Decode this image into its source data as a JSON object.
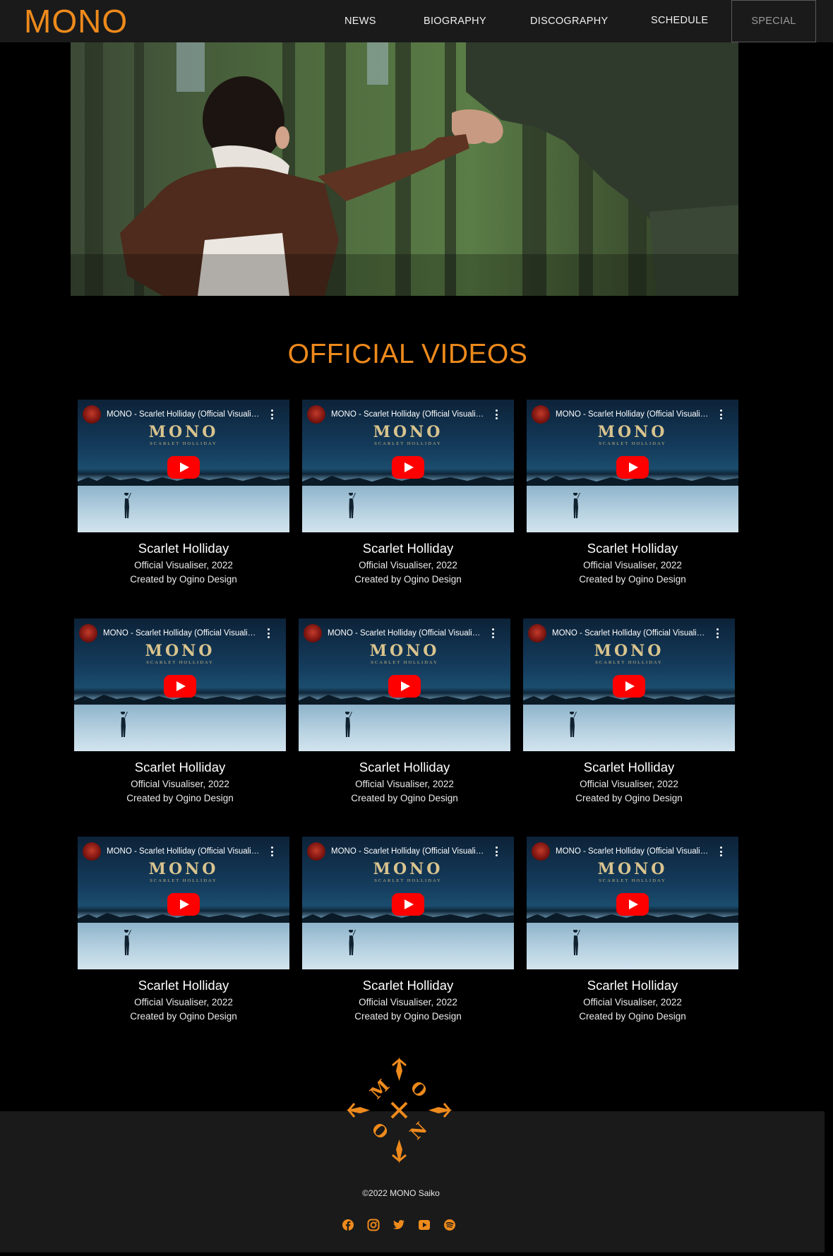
{
  "header": {
    "logo": "MONO",
    "nav": {
      "news": "NEWS",
      "biography": "BIOGRAPHY",
      "discography": "DISCOGRAPHY",
      "schedule": "SCHEDULE",
      "special": "SPECIAL"
    }
  },
  "section": {
    "title": "OFFICIAL VIDEOS"
  },
  "videos": [
    {
      "embed_title": "MONO - Scarlet Holliday (Official Visualiser)",
      "wordmark": "MONO",
      "wordmark_sub": "SCARLET HOLLIDAY",
      "title": "Scarlet Holliday",
      "line1": "Official Visualiser, 2022",
      "line2": "Created by Ogino Design"
    },
    {
      "embed_title": "MONO - Scarlet Holliday (Official Visualiser)",
      "wordmark": "MONO",
      "wordmark_sub": "SCARLET HOLLIDAY",
      "title": "Scarlet Holliday",
      "line1": "Official Visualiser, 2022",
      "line2": "Created by Ogino Design"
    },
    {
      "embed_title": "MONO - Scarlet Holliday (Official Visualiser)",
      "wordmark": "MONO",
      "wordmark_sub": "SCARLET HOLLIDAY",
      "title": "Scarlet Holliday",
      "line1": "Official Visualiser, 2022",
      "line2": "Created by Ogino Design"
    },
    {
      "embed_title": "MONO - Scarlet Holliday (Official Visualiser)",
      "wordmark": "MONO",
      "wordmark_sub": "SCARLET HOLLIDAY",
      "title": "Scarlet Holliday",
      "line1": "Official Visualiser, 2022",
      "line2": "Created by Ogino Design"
    },
    {
      "embed_title": "MONO - Scarlet Holliday (Official Visualiser)",
      "wordmark": "MONO",
      "wordmark_sub": "SCARLET HOLLIDAY",
      "title": "Scarlet Holliday",
      "line1": "Official Visualiser, 2022",
      "line2": "Created by Ogino Design"
    },
    {
      "embed_title": "MONO - Scarlet Holliday (Official Visualiser)",
      "wordmark": "MONO",
      "wordmark_sub": "SCARLET HOLLIDAY",
      "title": "Scarlet Holliday",
      "line1": "Official Visualiser, 2022",
      "line2": "Created by Ogino Design"
    },
    {
      "embed_title": "MONO - Scarlet Holliday (Official Visualiser)",
      "wordmark": "MONO",
      "wordmark_sub": "SCARLET HOLLIDAY",
      "title": "Scarlet Holliday",
      "line1": "Official Visualiser, 2022",
      "line2": "Created by Ogino Design"
    },
    {
      "embed_title": "MONO - Scarlet Holliday (Official Visualiser)",
      "wordmark": "MONO",
      "wordmark_sub": "SCARLET HOLLIDAY",
      "title": "Scarlet Holliday",
      "line1": "Official Visualiser, 2022",
      "line2": "Created by Ogino Design"
    },
    {
      "embed_title": "MONO - Scarlet Holliday (Official Visualiser)",
      "wordmark": "MONO",
      "wordmark_sub": "SCARLET HOLLIDAY",
      "title": "Scarlet Holliday",
      "line1": "Official Visualiser, 2022",
      "line2": "Created by Ogino Design"
    }
  ],
  "footer": {
    "emblem_letters": [
      "M",
      "O",
      "N",
      "O"
    ],
    "copyright": "©2022 MONO Saiko",
    "social": [
      "facebook-icon",
      "instagram-icon",
      "twitter-icon",
      "youtube-icon",
      "spotify-icon"
    ]
  },
  "colors": {
    "accent": "#ee8a1c",
    "header_bg": "#1a1a1a",
    "page_bg": "#000000",
    "play_button": "#ff0000"
  }
}
